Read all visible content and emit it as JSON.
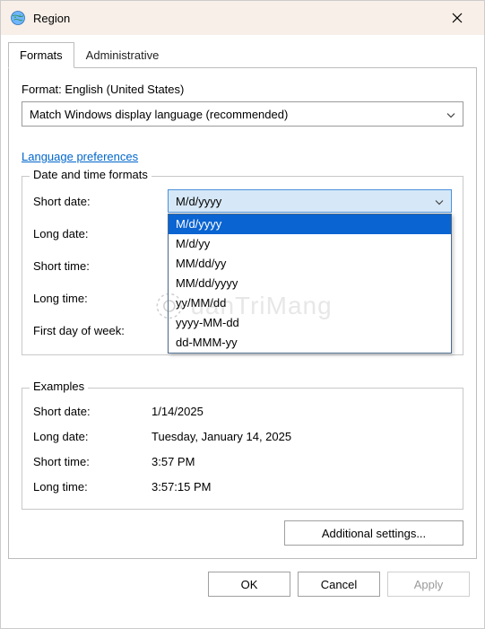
{
  "titlebar": {
    "title": "Region"
  },
  "tabs": {
    "formats": "Formats",
    "administrative": "Administrative"
  },
  "format": {
    "label": "Format: English (United States)",
    "selected": "Match Windows display language (recommended)"
  },
  "link": {
    "lang_prefs": "Language preferences"
  },
  "dtf": {
    "legend": "Date and time formats",
    "short_date_label": "Short date:",
    "long_date_label": "Long date:",
    "short_time_label": "Short time:",
    "long_time_label": "Long time:",
    "first_day_label": "First day of week:",
    "short_date_value": "M/d/yyyy",
    "options": {
      "o0": "M/d/yyyy",
      "o1": "M/d/yy",
      "o2": "MM/dd/yy",
      "o3": "MM/dd/yyyy",
      "o4": "yy/MM/dd",
      "o5": "yyyy-MM-dd",
      "o6": "dd-MMM-yy"
    }
  },
  "examples": {
    "legend": "Examples",
    "short_date_label": "Short date:",
    "short_date_value": "1/14/2025",
    "long_date_label": "Long date:",
    "long_date_value": "Tuesday, January 14, 2025",
    "short_time_label": "Short time:",
    "short_time_value": "3:57 PM",
    "long_time_label": "Long time:",
    "long_time_value": "3:57:15 PM"
  },
  "buttons": {
    "additional": "Additional settings...",
    "ok": "OK",
    "cancel": "Cancel",
    "apply": "Apply"
  },
  "watermark": {
    "text": "uanTriMang"
  }
}
